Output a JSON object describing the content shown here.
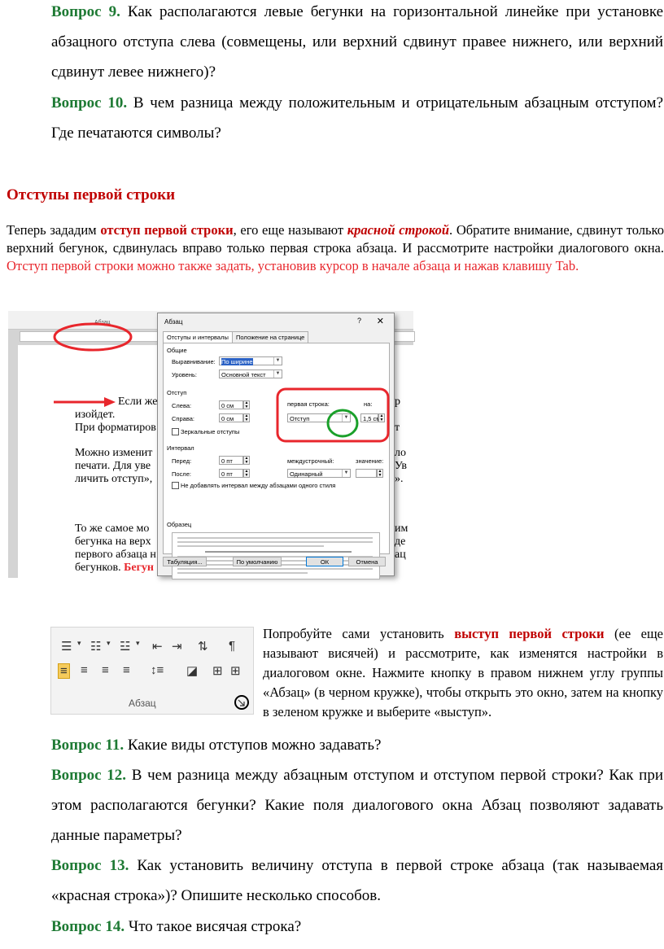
{
  "top": {
    "q9_label": "Вопрос 9.",
    "q9_text": " Как располагаются левые бегунки на горизонтальной линейке при установке абзацного отступа слева (совмещены, или верхний сдвинут правее нижнего, или  верхний сдвинут левее нижнего)?",
    "q10_label": "Вопрос 10.",
    "q10_text": " В чем разница между положительным и отрицательным абзацным отступом? Где печатаются символы?"
  },
  "section": {
    "heading": "Отступы первой строки",
    "p_a": "Теперь зададим ",
    "p_b": "отступ первой строки",
    "p_c": ",  его еще называют ",
    "p_d": "красной строкой",
    "p_e": ". Обратите внимание, сдвинут только верхний бегунок, сдвинулась вправо только первая строка абзаца. И рассмотрите настройки диалогового окна. ",
    "p_f": "Отступ первой строки  можно также задать, установив курсор в начале абзаца и нажав клавишу Tab."
  },
  "screenshot1": {
    "ribbon_label": "Абзац",
    "doc_lines": [
      "Если же",
      "изойдет.",
      "При форматиров",
      "Можно изменит",
      "печати. Для уве",
      "личить отступ»,",
      "То же самое мо",
      "бегунка на верх",
      "первого абзаца н",
      "бегунков. "
    ],
    "doc_red": "Бегун",
    "doc_right": [
      "р",
      "т",
      "ло",
      "Ув",
      "».",
      "им",
      "де",
      "ац"
    ],
    "dialog": {
      "title": "Абзац",
      "help": "?",
      "close": "✕",
      "tabs": [
        "Отступы и интервалы",
        "Положение на странице"
      ],
      "general": "Общие",
      "align_label": "Выравнивание:",
      "align_value": "По ширине",
      "level_label": "Уровень:",
      "level_value": "Основной текст",
      "indent": "Отступ",
      "left_label": "Слева:",
      "left_value": "0 см",
      "right_label": "Справа:",
      "right_value": "0 см",
      "mirror_label": "Зеркальные отступы",
      "first_line_label": "первая строка:",
      "first_line_value": "Отступ",
      "on_label": "на:",
      "on_value": "1,5 см",
      "interval": "Интервал",
      "before_label": "Перед:",
      "before_value": "0 пт",
      "after_label": "После:",
      "after_value": "0 пт",
      "line_label": "междустрочный:",
      "line_value": "Одинарный",
      "value_label": "значение:",
      "no_space_label": "Не добавлять интервал между абзацами одного стиля",
      "sample": "Образец",
      "btn_tabs": "Табуляция...",
      "btn_default": "По умолчанию",
      "btn_ok": "ОК",
      "btn_cancel": "Отмена"
    }
  },
  "screenshot2": {
    "group_label": "Абзац"
  },
  "side": {
    "a": "Попробуйте сами установить ",
    "b": "выступ первой строки",
    "c": " (ее еще называют висячей) и рассмотрите, как изменятся настройки в диалоговом окне. Нажмите кнопку в правом нижнем углу группы «Абзац» (в черном кружке), чтобы открыть это окно, затем на кнопку в зеленом кружке и выберите «выступ»."
  },
  "bottom": {
    "q11_label": "Вопрос 11.",
    "q11_text": " Какие виды отступов можно задавать?",
    "q12_label": "Вопрос 12.",
    "q12_text": " В чем разница между абзацным отступом и отступом первой строки? Как при этом располагаются бегунки? Какие поля диалогового окна Абзац позволяют задавать данные параметры?",
    "q13_label": "Вопрос 13.",
    "q13_text": " Как установить величину отступа в первой строке абзаца (так называемая «красная строка»)? Опишите несколько способов.",
    "q14_label": "Вопрос 14.",
    "q14_text": " Что такое висячая строка?"
  },
  "colors": {
    "question": "#1e7a34",
    "heading": "#c00000",
    "accent_red": "#e8262c",
    "circle_green": "#1aa02a"
  }
}
